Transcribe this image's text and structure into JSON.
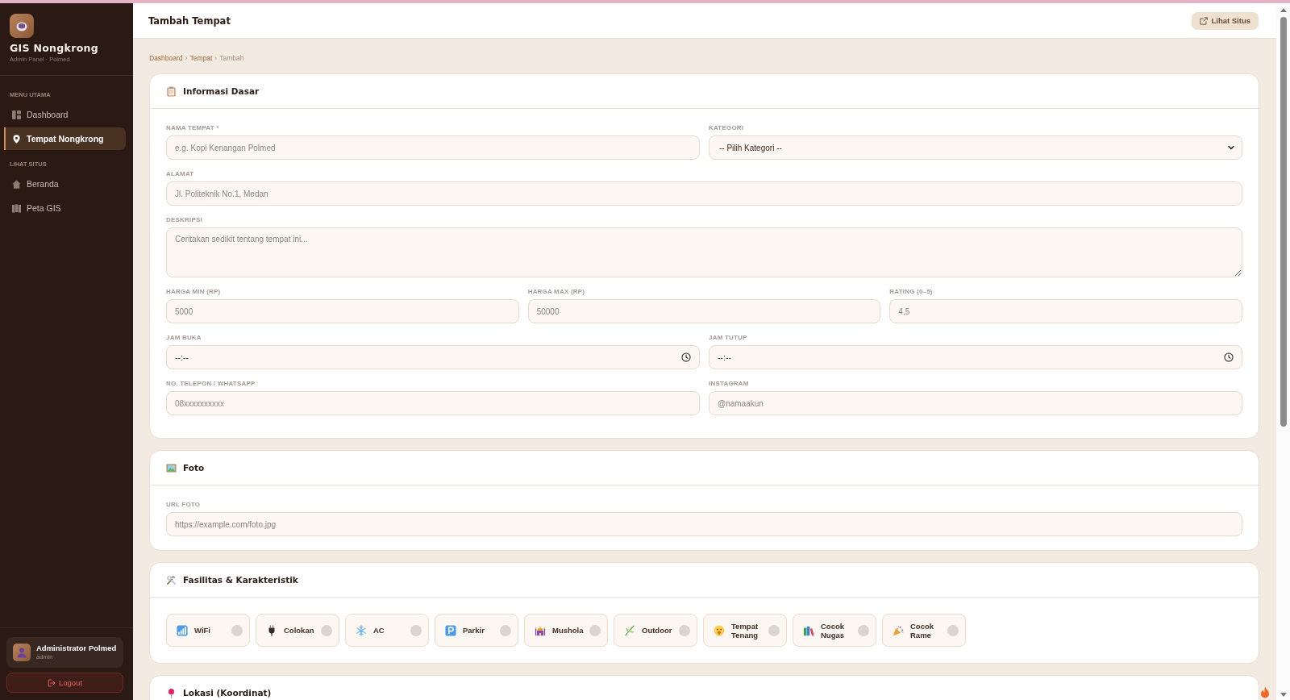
{
  "sidebar": {
    "brand": {
      "title": "GIS Nongkrong",
      "subtitle": "Admin Panel · Polmed"
    },
    "sections": [
      {
        "heading": "MENU UTAMA",
        "items": [
          {
            "label": "Dashboard",
            "selected": false
          },
          {
            "label": "Tempat Nongkrong",
            "selected": true
          }
        ]
      },
      {
        "heading": "LIHAT SITUS",
        "items": [
          {
            "label": "Beranda",
            "selected": false
          },
          {
            "label": "Peta GIS",
            "selected": false
          }
        ]
      }
    ],
    "user": {
      "name": "Administrator Polmed",
      "role": "admin"
    },
    "logout": "Logout"
  },
  "header": {
    "title": "Tambah Tempat",
    "action": "Lihat Situs"
  },
  "breadcrumb": [
    {
      "label": "Dashboard",
      "current": false
    },
    {
      "separator": "›",
      "label": "Tempat",
      "current": false
    },
    {
      "separator": "›",
      "label": "Tambah",
      "current": true
    }
  ],
  "sections": [
    {
      "kind": "fields",
      "title": "Informasi Dasar",
      "rows": [
        [
          {
            "kind": "text",
            "label": "NAMA TEMPAT *",
            "placeholder": "e.g. Kopi Kenangan Polmed"
          },
          {
            "kind": "select",
            "label": "KATEGORI",
            "value": "-- Pilih Kategori --"
          }
        ],
        [
          {
            "kind": "text",
            "label": "ALAMAT",
            "placeholder": "Jl. Politeknik No.1, Medan"
          }
        ],
        [
          {
            "kind": "textarea",
            "label": "DESKRIPSI",
            "placeholder": "Ceritakan sedikit tentang tempat ini..."
          }
        ],
        [
          {
            "kind": "text",
            "label": "HARGA MIN (RP)",
            "placeholder": "5000"
          },
          {
            "kind": "text",
            "label": "HARGA MAX (RP)",
            "placeholder": "50000"
          },
          {
            "kind": "text",
            "label": "RATING (0–5)",
            "placeholder": "4.5"
          }
        ],
        [
          {
            "kind": "time",
            "label": "JAM BUKA",
            "placeholder": "--:--"
          },
          {
            "kind": "time",
            "label": "JAM TUTUP",
            "placeholder": "--:--"
          }
        ],
        [
          {
            "kind": "text",
            "label": "NO. TELEPON / WHATSAPP",
            "placeholder": "08xxxxxxxxxx"
          },
          {
            "kind": "text",
            "label": "INSTAGRAM",
            "placeholder": "@namaakun"
          }
        ]
      ]
    },
    {
      "kind": "fields",
      "title": "Foto",
      "rows": [
        [
          {
            "kind": "text",
            "label": "URL FOTO",
            "placeholder": "https://example.com/foto.jpg"
          }
        ]
      ]
    },
    {
      "kind": "facilities",
      "title": "Fasilitas & Karakteristik",
      "items": [
        {
          "label": "WiFi",
          "checked": false
        },
        {
          "label": "Colokan",
          "checked": false
        },
        {
          "label": "AC",
          "checked": false
        },
        {
          "label": "Parkir",
          "checked": false
        },
        {
          "label": "Mushola",
          "checked": false
        },
        {
          "label": "Outdoor",
          "checked": false
        },
        {
          "label": "Tempat Tenang",
          "checked": false
        },
        {
          "label": "Cocok Nugas",
          "checked": false
        },
        {
          "label": "Cocok Rame",
          "checked": false
        }
      ]
    },
    {
      "kind": "fields",
      "title": "Lokasi (Koordinat)"
    }
  ]
}
